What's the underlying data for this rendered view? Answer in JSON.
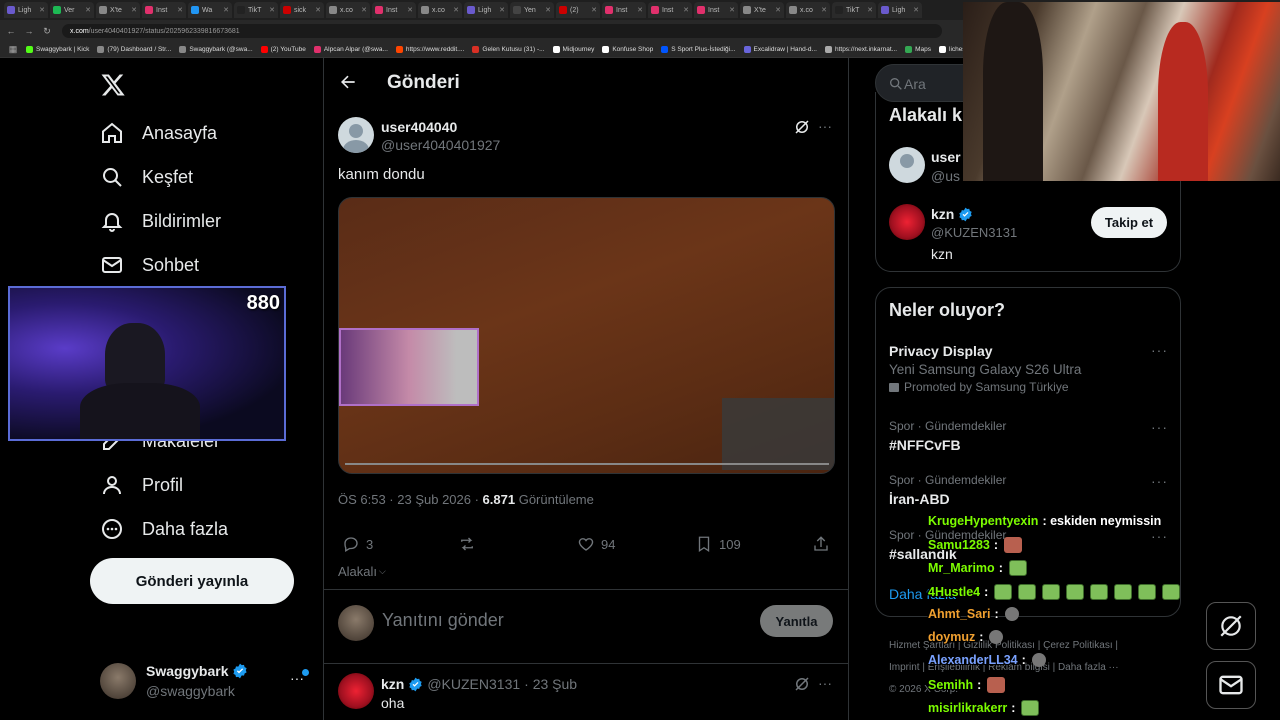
{
  "browser": {
    "tabs": [
      "Ligh",
      "Ver",
      "X'te",
      "Inst",
      "Wa",
      "TikT",
      "sick",
      "x.co",
      "Inst",
      "x.co",
      "Ligh",
      "Yen",
      "(2)",
      "Inst",
      "Inst",
      "Inst",
      "X'te",
      "x.co",
      "TikT",
      "Ligh"
    ],
    "tab_colors": [
      "#6a5acd",
      "#1db954",
      "#888",
      "#e1306c",
      "#2196f3",
      "#222",
      "#c00",
      "#888",
      "#e1306c",
      "#888",
      "#6a5acd",
      "#444",
      "#c00",
      "#e1306c",
      "#e1306c",
      "#e1306c",
      "#888",
      "#888",
      "#222",
      "#6a5acd"
    ],
    "url_host": "x.com",
    "url_path": "/user4040401927/status/2025962339816673681",
    "bookmarks": [
      "Swaggybark | Kick",
      "(79) Dashboard / Str...",
      "Swaggybark (@swa...",
      "(2) YouTube",
      "Alpcan Alpar (@swa...",
      "https://www.reddit....",
      "Gelen Kutusu (31) -...",
      "Midjourney",
      "Konfuse Shop",
      "S Sport Plus-İstediği...",
      "Excalidraw | Hand-d...",
      "https://next.inkarnat...",
      "Maps",
      "lichess.org"
    ],
    "bookmark_colors": [
      "#53fc18",
      "#888",
      "#888",
      "#f00",
      "#e1306c",
      "#ff4500",
      "#d93025",
      "#fff",
      "#fff",
      "#0055ff",
      "#6965db",
      "#aaa",
      "#34a853",
      "#fff"
    ]
  },
  "nav": {
    "logo": "X",
    "items": [
      {
        "label": "Anasayfa",
        "icon": "home-icon"
      },
      {
        "label": "Keşfet",
        "icon": "search-icon"
      },
      {
        "label": "Bildirimler",
        "icon": "bell-icon"
      },
      {
        "label": "Sohbet",
        "icon": "mail-icon"
      },
      {
        "label": "Makaleler",
        "icon": "article-icon"
      },
      {
        "label": "Profil",
        "icon": "person-icon"
      },
      {
        "label": "Daha fazla",
        "icon": "more-circle-icon"
      }
    ],
    "post_button": "Gönderi yayınla",
    "account_name": "Swaggybark",
    "account_handle": "@swaggybark"
  },
  "webcam": {
    "viewer_count": "880"
  },
  "post": {
    "header_title": "Gönderi",
    "author_name": "user404040",
    "author_handle": "@user4040401927",
    "text": "kanım dondu",
    "time": "ÖS 6:53 · 23 Şub 2026 · ",
    "views": "6.871",
    "views_label": " Görüntüleme",
    "replies": "3",
    "likes": "94",
    "bookmarks": "109",
    "relevance": "Alakalı",
    "reply_placeholder": "Yanıtını gönder",
    "reply_button": "Yanıtla"
  },
  "reply": {
    "author_name": "kzn",
    "author_handle": "@KUZEN3131",
    "date": "· 23 Şub",
    "text": "oha"
  },
  "right": {
    "search_placeholder": "Ara",
    "related_title": "Alakalı k",
    "related_user1_name": "user",
    "related_user1_handle": "@us",
    "related_user2_name": "kzn",
    "related_user2_handle": "@KUZEN3131",
    "related_user2_bio": "kzn",
    "follow_button": "Takip et",
    "trends_title": "Neler oluyor?",
    "trends": [
      {
        "category": "",
        "title": "Privacy Display",
        "subtitle": "Yeni Samsung Galaxy S26 Ultra",
        "promo": "Promoted by Samsung Türkiye"
      },
      {
        "category": "Spor · Gündemdekiler",
        "title": "#NFFCvFB"
      },
      {
        "category": "Spor · Gündemdekiler",
        "title": "İran-ABD"
      },
      {
        "category": "Spor · Gündemdekiler",
        "title": "#sallandık"
      }
    ],
    "show_more": "Daha fazla",
    "footer_line1": [
      "Hizmet Şartları",
      "Gizlilik Politikası",
      "Çerez Politikası"
    ],
    "footer_line2": [
      "Imprint",
      "Erişilebilirlik",
      "Reklam bilgisi",
      "Daha fazla ···"
    ],
    "copyright": "© 2026 X Corp."
  },
  "chat": [
    {
      "user": "KrugeHypentyexin",
      "color": "#7cfc00",
      "msg": ": eskiden neymissin",
      "emotes": []
    },
    {
      "user": "Samu1283",
      "color": "#7cfc00",
      "msg": ":",
      "emotes": [
        "red"
      ]
    },
    {
      "user": "Mr_Marimo",
      "color": "#7cfc00",
      "msg": ":",
      "emotes": [
        "green"
      ]
    },
    {
      "user": "4Hustle4",
      "color": "#7cfc00",
      "msg": ":",
      "emotes": [
        "green",
        "green",
        "green",
        "green",
        "green",
        "green",
        "green",
        "green"
      ]
    },
    {
      "user": "Ahmt_Sari",
      "color": "#f0a030",
      "msg": ":",
      "emotes": [
        "face"
      ]
    },
    {
      "user": "doymuz",
      "color": "#f0a030",
      "msg": ":",
      "emotes": [
        "face"
      ]
    },
    {
      "user": "AlexanderLL34",
      "color": "#7aa2ff",
      "msg": ":",
      "emotes": [
        "face"
      ]
    },
    {
      "user": "Semihh",
      "color": "#7cfc00",
      "msg": ":",
      "emotes": [
        "red"
      ]
    },
    {
      "user": "misirlikrakerr",
      "color": "#7cfc00",
      "msg": ":",
      "emotes": [
        "green"
      ]
    }
  ]
}
